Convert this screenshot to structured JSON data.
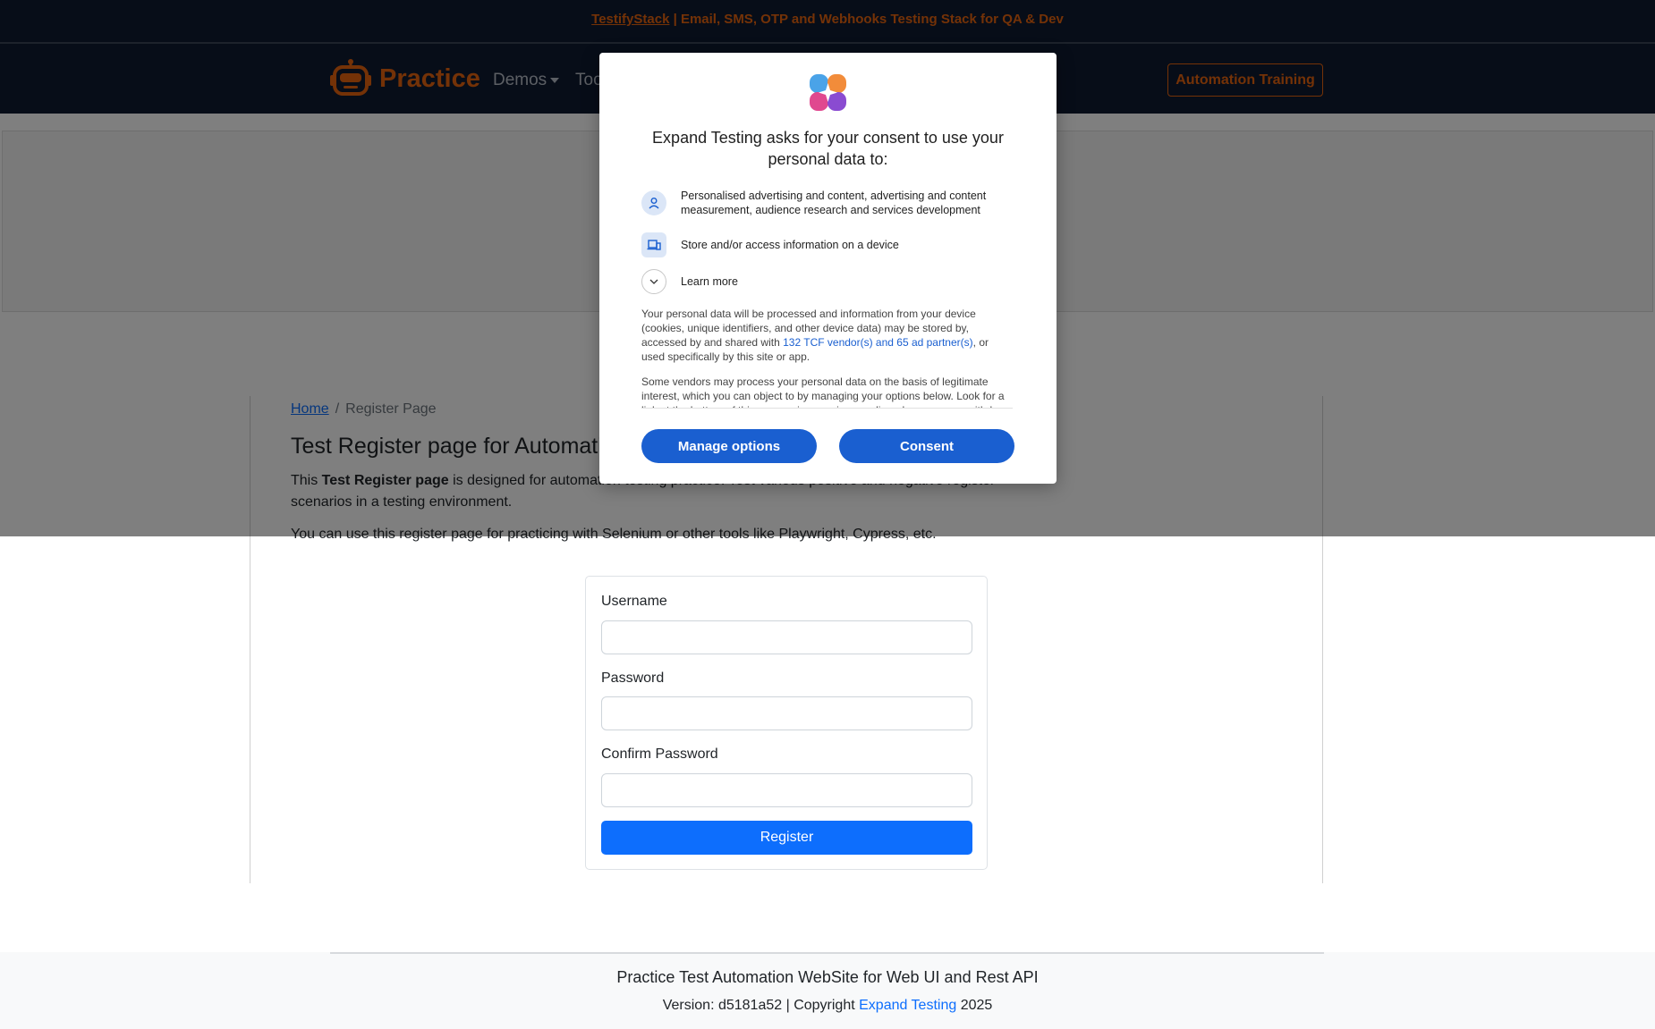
{
  "banner": {
    "link": "TestifyStack",
    "text": " | Email, SMS, OTP and Webhooks Testing Stack for QA & Dev"
  },
  "navbar": {
    "brand": "Practice",
    "demos": "Demos",
    "tools": "Too",
    "training_button": "Automation Training"
  },
  "breadcrumb": {
    "home": "Home",
    "separator": "/",
    "current": "Register Page"
  },
  "main": {
    "title": "Test Register page for Automation Testing Practice",
    "intro_prefix": "This ",
    "intro_bold": "Test Register page",
    "intro_suffix": " is designed for automation testing practice. Test various positive and negative register scenarios in a testing environment.",
    "intro2": "You can use this register page for practicing with Selenium or other tools like Playwright, Cypress, etc."
  },
  "form": {
    "username_label": "Username",
    "username_value": "",
    "password_label": "Password",
    "password_value": "",
    "confirm_label": "Confirm Password",
    "confirm_value": "",
    "register_button": "Register"
  },
  "footer": {
    "title": "Practice Test Automation WebSite for Web UI and Rest API",
    "version_prefix": "Version: d5181a52 | Copyright ",
    "version_link": "Expand Testing",
    "version_suffix": " 2025"
  },
  "consent": {
    "title": "Expand Testing asks for your consent to use your personal data to:",
    "purpose1": "Personalised advertising and content, advertising and content measurement, audience research and services development",
    "purpose2": "Store and/or access information on a device",
    "learn_more": "Learn more",
    "body1_prefix": "Your personal data will be processed and information from your device (cookies, unique identifiers, and other device data) may be stored by, accessed by and shared with ",
    "body1_link": "132 TCF vendor(s) and 65 ad partner(s)",
    "body1_suffix": ", or used specifically by this site or app.",
    "body2": "Some vendors may process your personal data on the basis of legitimate interest, which you can object to by managing your options below. Look for a link at the bottom of this page or in our privacy policy where you can withdraw consent.",
    "manage_button": "Manage options",
    "consent_button": "Consent"
  },
  "colors": {
    "brand": "#e8650f",
    "navbar_bg": "#0f1a30",
    "primary": "#0d6efd",
    "consent_blue": "#1a5fd0"
  },
  "icons": [
    "robot-logo-icon",
    "caret-down-icon",
    "consent-logo-icon",
    "person-icon",
    "device-icon",
    "chevron-down-icon"
  ]
}
